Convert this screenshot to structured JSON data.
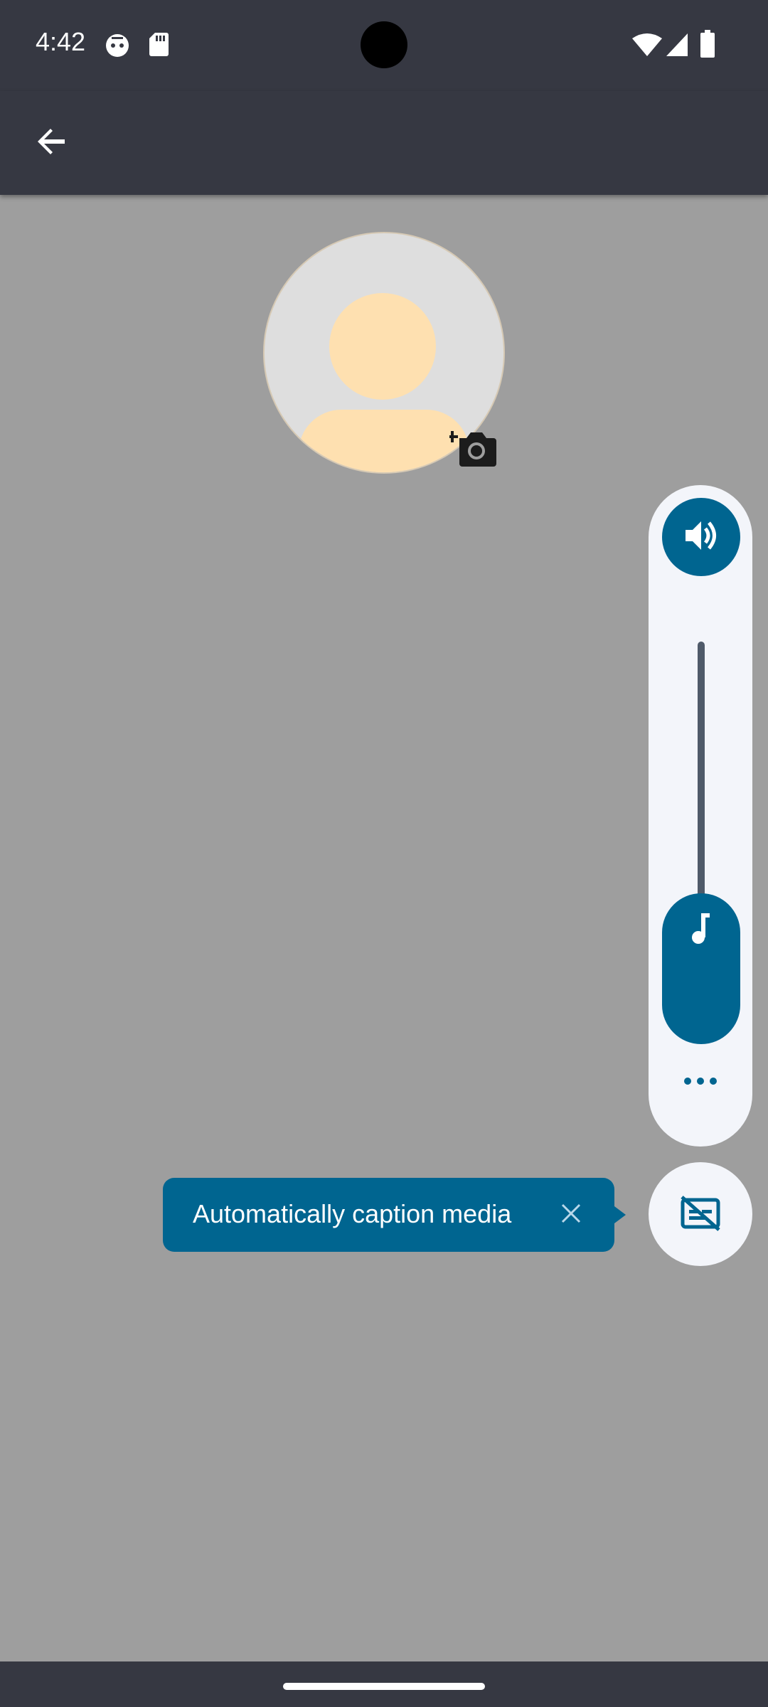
{
  "status_bar": {
    "time": "4:42",
    "icons": [
      "cat-notification-icon",
      "sd-card-icon",
      "wifi-icon",
      "cell-signal-icon",
      "battery-icon"
    ]
  },
  "app_bar": {
    "back_icon": "arrow-back-icon"
  },
  "avatar": {
    "icon": "default-avatar-icon",
    "add_photo_icon": "add-photo-camera-icon"
  },
  "volume_panel": {
    "ringer_icon": "volume-up-icon",
    "media_icon": "music-note-icon",
    "media_level_percent": 0,
    "more_icon": "more-horizontal-icon"
  },
  "caption": {
    "button_icon": "captions-off-icon",
    "tooltip_text": "Automatically caption media",
    "close_icon": "close-icon"
  },
  "colors": {
    "system_bar": "#363842",
    "scrim": "#9e9e9e",
    "accent": "#006590",
    "panel": "#f3f5fa",
    "avatar_skin": "#fee0b0"
  }
}
